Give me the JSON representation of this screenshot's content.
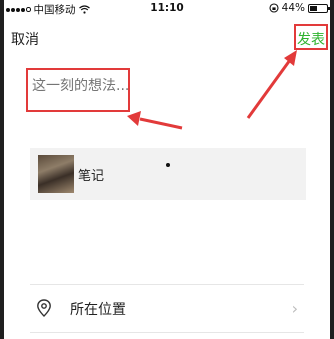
{
  "status_bar": {
    "carrier": "中国移动",
    "time": "11:10",
    "battery_percent": "44%",
    "battery_level": 0.44
  },
  "nav": {
    "cancel_label": "取消",
    "publish_label": "发表"
  },
  "composer": {
    "placeholder": "这一刻的想法..."
  },
  "attachment": {
    "title": "笔记"
  },
  "location": {
    "label": "所在位置",
    "chevron": "›"
  },
  "colors": {
    "publish_green": "#2fb32f",
    "annotation_red": "#e23a3a"
  }
}
